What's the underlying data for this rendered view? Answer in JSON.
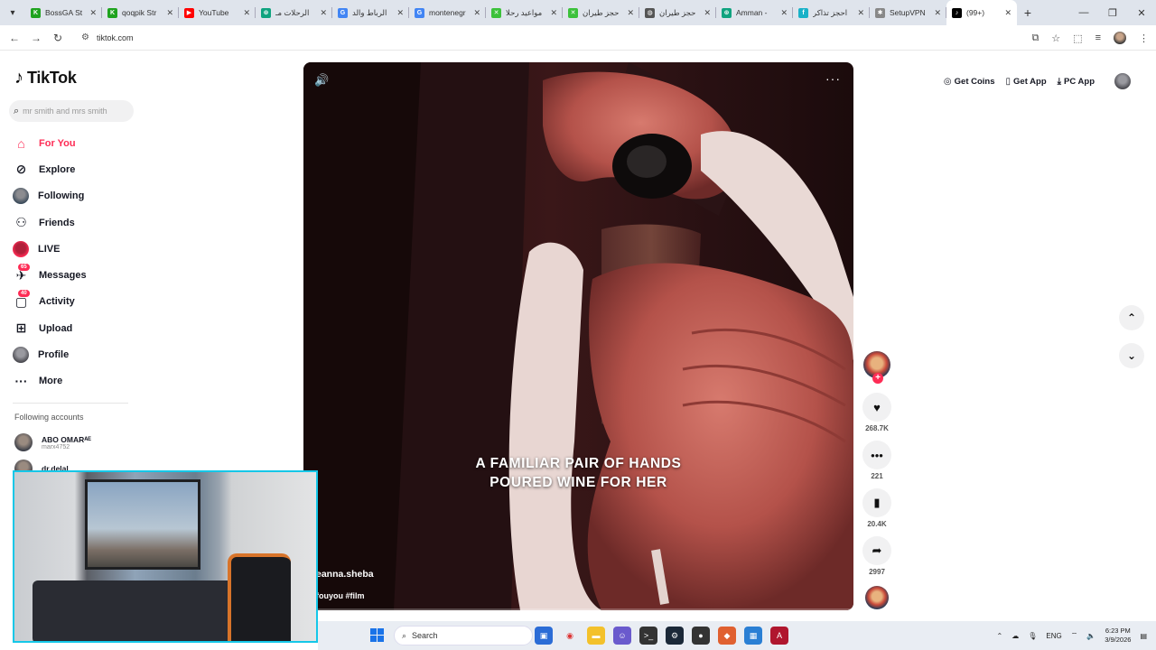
{
  "browser": {
    "tabs": [
      {
        "title": "BossGA St",
        "icon": "bossga-favicon",
        "color": "#1fa31f",
        "letter": "K"
      },
      {
        "title": "qoqpik Str",
        "icon": "qoqpik-favicon",
        "color": "#1fa31f",
        "letter": "K"
      },
      {
        "title": "YouTube",
        "icon": "youtube-favicon",
        "color": "#ff0000",
        "letter": "▶"
      },
      {
        "title": "الرحلات مـ",
        "icon": "chatgpt-favicon",
        "color": "#10a37f",
        "letter": "⊛"
      },
      {
        "title": "الرباط والد",
        "icon": "google-favicon",
        "color": "#4285f4",
        "letter": "G"
      },
      {
        "title": "montenegr",
        "icon": "google-favicon",
        "color": "#4285f4",
        "letter": "G"
      },
      {
        "title": "مواعيد رحلا",
        "icon": "sheet-favicon",
        "color": "#3cc13b",
        "letter": "✕"
      },
      {
        "title": "حجز طيران",
        "icon": "sheet-favicon",
        "color": "#3cc13b",
        "letter": "✕"
      },
      {
        "title": "حجز طيران",
        "icon": "globe-favicon",
        "color": "#555555",
        "letter": "◍"
      },
      {
        "title": "Amman -",
        "icon": "chatgpt-favicon",
        "color": "#10a37f",
        "letter": "⊛"
      },
      {
        "title": "احجز تذاكر",
        "icon": "booking-favicon",
        "color": "#19b1c8",
        "letter": "f"
      },
      {
        "title": "SetupVPN",
        "icon": "puzzle-favicon",
        "color": "#888888",
        "letter": "✱"
      },
      {
        "title": "(99+) ‎‎",
        "icon": "tiktok-favicon",
        "color": "#000000",
        "letter": "♪",
        "active": true
      }
    ],
    "url": "tiktok.com"
  },
  "sidebar": {
    "logo": "TikTok",
    "search_placeholder": "mr smith and mrs smith",
    "nav": [
      {
        "label": "For You",
        "icon": "home-icon",
        "glyph": "⌂",
        "active": true
      },
      {
        "label": "Explore",
        "icon": "compass-icon",
        "glyph": "⊘"
      },
      {
        "label": "Following",
        "icon": "following-avatar",
        "glyph": ""
      },
      {
        "label": "Friends",
        "icon": "friends-icon",
        "glyph": "⚇"
      },
      {
        "label": "LIVE",
        "icon": "live-avatar",
        "glyph": ""
      },
      {
        "label": "Messages",
        "icon": "messages-icon",
        "glyph": "✈",
        "badge": "65"
      },
      {
        "label": "Activity",
        "icon": "activity-icon",
        "glyph": "▢",
        "badge": "40"
      },
      {
        "label": "Upload",
        "icon": "upload-icon",
        "glyph": "⊞"
      },
      {
        "label": "Profile",
        "icon": "profile-avatar",
        "glyph": ""
      },
      {
        "label": "More",
        "icon": "more-icon",
        "glyph": "···"
      }
    ],
    "following_heading": "Following accounts",
    "accounts": [
      {
        "name": "ABO OMARᴬᴱ",
        "handle": "marx4752"
      },
      {
        "name": "dr.delal",
        "handle": ""
      }
    ]
  },
  "header": {
    "get_coins": "Get Coins",
    "get_app": "Get App",
    "pc_app": "PC App"
  },
  "video": {
    "caption_line1": "A FAMILIAR PAIR OF HANDS",
    "caption_line2": "POURED WINE FOR HER",
    "author": "eanna.sheba",
    "hashtags": "fouyou #film"
  },
  "actions": {
    "likes": "268.7K",
    "comments": "221",
    "saves": "20.4K",
    "shares": "2997"
  },
  "taskbar": {
    "search_label": "Search",
    "lang": "ENG",
    "time": "6:23 PM",
    "date": "3/9/2026"
  }
}
